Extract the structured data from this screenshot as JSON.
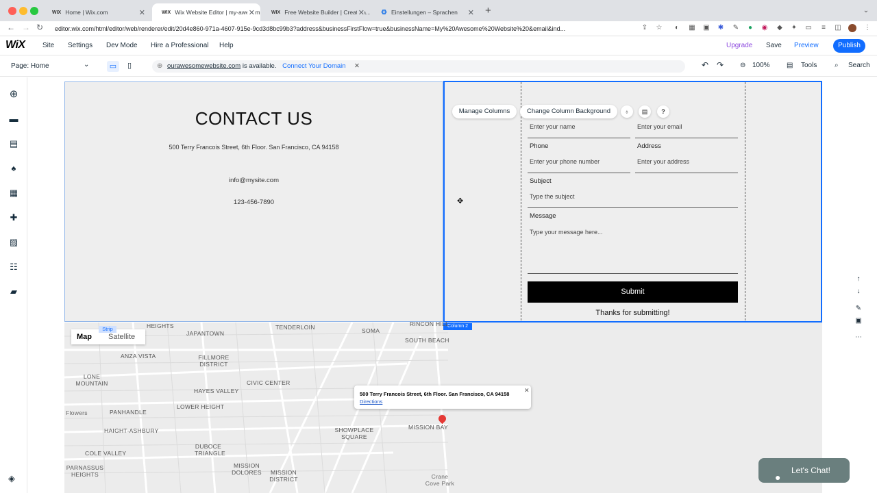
{
  "browser": {
    "tabs": [
      {
        "favicon": "WIX",
        "title": "Home | Wix.com"
      },
      {
        "favicon": "WIX",
        "title": "Wix Website Editor | my-awesome..."
      },
      {
        "favicon": "WIX",
        "title": "Free Website Builder | Create a..."
      },
      {
        "favicon": "gear-icon",
        "title": "Einstellungen – Sprachen"
      }
    ],
    "url": "editor.wix.com/html/editor/web/renderer/edit/20d4e860-971a-4607-915e-9cd3d8bc99b3?address&businessFirstFlow=true&businessName=My%20Awesome%20Website%20&email&ind..."
  },
  "wixbar": {
    "logo": "WiX",
    "menu": [
      "Site",
      "Settings",
      "Dev Mode",
      "Hire a Professional",
      "Help"
    ],
    "upgrade": "Upgrade",
    "save": "Save",
    "preview": "Preview",
    "publish": "Publish",
    "accent": "#116dff"
  },
  "toolbar2": {
    "page_label": "Page: Home",
    "domain": "ourawesomewebsite.com",
    "domain_suffix": " is available.",
    "connect": "Connect Your Domain",
    "zoom": "100%",
    "tools": "Tools",
    "search": "Search"
  },
  "contact": {
    "title": "CONTACT US",
    "address": "500 Terry Francois Street, 6th Floor. San Francisco, CA 94158",
    "email": "info@mysite.com",
    "phone": "123-456-7890"
  },
  "column_controls": {
    "manage": "Manage Columns",
    "background": "Change Column Background",
    "column_tag": "Column 2",
    "strip_tag": "Strip"
  },
  "form": {
    "name_placeholder": "Enter your name",
    "email_placeholder": "Enter your email",
    "phone_label": "Phone",
    "phone_placeholder": "Enter your phone number",
    "address_label": "Address",
    "address_placeholder": "Enter your address",
    "subject_label": "Subject",
    "subject_placeholder": "Type the subject",
    "message_label": "Message",
    "message_placeholder": "Type your message here...",
    "submit": "Submit",
    "thanks": "Thanks for submitting!"
  },
  "map": {
    "toggle_map": "Map",
    "toggle_satellite": "Satellite",
    "labels": [
      "HEIGHTS",
      "JAPANTOWN",
      "TENDERLOIN",
      "SOMA",
      "RINCON HILL",
      "SOUTH BEACH",
      "ANZA VISTA",
      "FILLMORE DISTRICT",
      "LONE MOUNTAIN",
      "CIVIC CENTER",
      "HAYES VALLEY",
      "PANHANDLE",
      "LOWER HEIGHT",
      "HAIGHT-ASHBURY",
      "SHOWPLACE SQUARE",
      "MISSION BAY",
      "COLE VALLEY",
      "DUBOCE TRIANGLE",
      "MISSION DOLORES",
      "MISSION DISTRICT",
      "PARNASSUS HEIGHTS",
      "Flowers",
      "Crane Cove Park"
    ],
    "info_address": "500 Terry Francois Street, 6th Floor. San Francisco, CA 94158",
    "info_link": "Directions"
  },
  "chat": {
    "label": "Let's Chat!"
  }
}
